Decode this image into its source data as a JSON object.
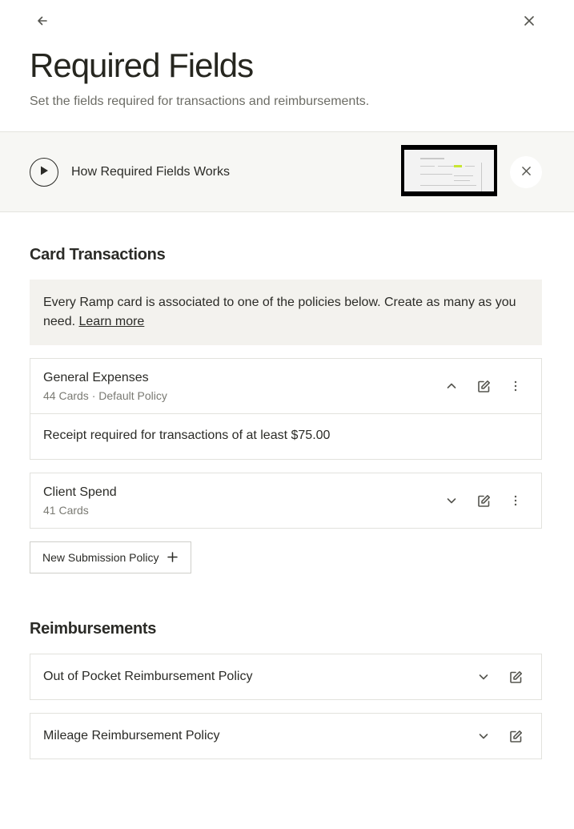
{
  "header": {
    "back_icon": "arrow-left-icon",
    "close_icon": "close-icon",
    "title": "Required Fields",
    "subtitle": "Set the fields required for transactions and reimbursements."
  },
  "video_banner": {
    "play_icon": "play-icon",
    "title": "How Required Fields Works",
    "dismiss_icon": "close-icon"
  },
  "card_transactions": {
    "section_title": "Card Transactions",
    "info_text": "Every Ramp card is associated to one of the policies below. Create as many as you need.",
    "info_link": "Learn more",
    "policies": [
      {
        "name": "General Expenses",
        "meta": "44 Cards · Default Policy",
        "expanded": true,
        "rule": "Receipt required for transactions of at least $75.00"
      },
      {
        "name": "Client Spend",
        "meta": "41 Cards",
        "expanded": false
      }
    ],
    "new_policy_label": "New Submission Policy"
  },
  "reimbursements": {
    "section_title": "Reimbursements",
    "policies": [
      {
        "name": "Out of Pocket Reimbursement Policy"
      },
      {
        "name": "Mileage Reimbursement Policy"
      }
    ]
  }
}
